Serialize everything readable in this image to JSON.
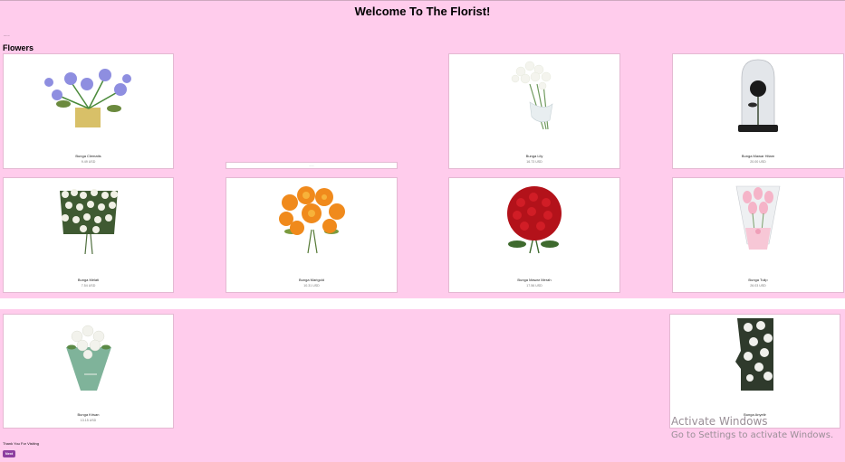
{
  "header": {
    "title": "Welcome To The Florist!",
    "tiny_mark": "......"
  },
  "section": {
    "title": "Flowers"
  },
  "flowers": [
    {
      "name": "Bunga Clematis",
      "price": "9.49 USD"
    },
    {
      "name": "Bunga Lily",
      "price": "16.73 USD"
    },
    {
      "name": "Bunga Mawar Hitam",
      "price": "20.00 USD"
    },
    {
      "name": "Bunga Melati",
      "price": "7.54 USD"
    },
    {
      "name": "Bunga Marigold",
      "price": "10.31 USD"
    },
    {
      "name": "Bunga Mawar Merah",
      "price": "17.56 USD"
    },
    {
      "name": "Bunga Tulip",
      "price": "26.03 USD"
    },
    {
      "name": "Bunga Krisan",
      "price": "13.15 USD"
    },
    {
      "name": "Bunga Anyelir",
      "price": ""
    }
  ],
  "collapsed_card": {
    "label": "......"
  },
  "footer": {
    "thanks": "Thank You For Visiting",
    "next_label": "Next"
  },
  "watermark": {
    "line1": "Activate Windows",
    "line2": "Go to Settings to activate Windows."
  },
  "colors": {
    "background": "#ffccec",
    "button": "#8e3e9f"
  }
}
